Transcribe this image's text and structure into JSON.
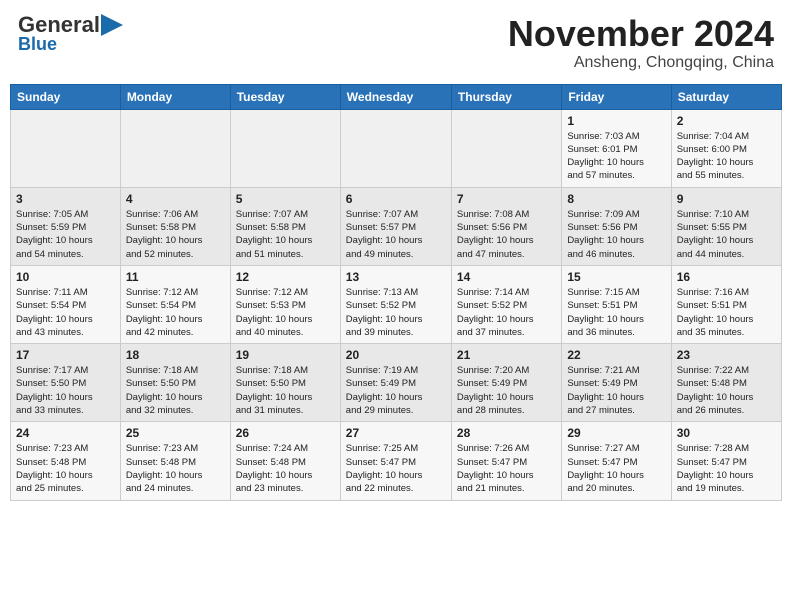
{
  "header": {
    "logo_line1": "General",
    "logo_line2": "Blue",
    "title": "November 2024",
    "subtitle": "Ansheng, Chongqing, China"
  },
  "weekdays": [
    "Sunday",
    "Monday",
    "Tuesday",
    "Wednesday",
    "Thursday",
    "Friday",
    "Saturday"
  ],
  "weeks": [
    [
      {
        "day": "",
        "info": ""
      },
      {
        "day": "",
        "info": ""
      },
      {
        "day": "",
        "info": ""
      },
      {
        "day": "",
        "info": ""
      },
      {
        "day": "",
        "info": ""
      },
      {
        "day": "1",
        "info": "Sunrise: 7:03 AM\nSunset: 6:01 PM\nDaylight: 10 hours\nand 57 minutes."
      },
      {
        "day": "2",
        "info": "Sunrise: 7:04 AM\nSunset: 6:00 PM\nDaylight: 10 hours\nand 55 minutes."
      }
    ],
    [
      {
        "day": "3",
        "info": "Sunrise: 7:05 AM\nSunset: 5:59 PM\nDaylight: 10 hours\nand 54 minutes."
      },
      {
        "day": "4",
        "info": "Sunrise: 7:06 AM\nSunset: 5:58 PM\nDaylight: 10 hours\nand 52 minutes."
      },
      {
        "day": "5",
        "info": "Sunrise: 7:07 AM\nSunset: 5:58 PM\nDaylight: 10 hours\nand 51 minutes."
      },
      {
        "day": "6",
        "info": "Sunrise: 7:07 AM\nSunset: 5:57 PM\nDaylight: 10 hours\nand 49 minutes."
      },
      {
        "day": "7",
        "info": "Sunrise: 7:08 AM\nSunset: 5:56 PM\nDaylight: 10 hours\nand 47 minutes."
      },
      {
        "day": "8",
        "info": "Sunrise: 7:09 AM\nSunset: 5:56 PM\nDaylight: 10 hours\nand 46 minutes."
      },
      {
        "day": "9",
        "info": "Sunrise: 7:10 AM\nSunset: 5:55 PM\nDaylight: 10 hours\nand 44 minutes."
      }
    ],
    [
      {
        "day": "10",
        "info": "Sunrise: 7:11 AM\nSunset: 5:54 PM\nDaylight: 10 hours\nand 43 minutes."
      },
      {
        "day": "11",
        "info": "Sunrise: 7:12 AM\nSunset: 5:54 PM\nDaylight: 10 hours\nand 42 minutes."
      },
      {
        "day": "12",
        "info": "Sunrise: 7:12 AM\nSunset: 5:53 PM\nDaylight: 10 hours\nand 40 minutes."
      },
      {
        "day": "13",
        "info": "Sunrise: 7:13 AM\nSunset: 5:52 PM\nDaylight: 10 hours\nand 39 minutes."
      },
      {
        "day": "14",
        "info": "Sunrise: 7:14 AM\nSunset: 5:52 PM\nDaylight: 10 hours\nand 37 minutes."
      },
      {
        "day": "15",
        "info": "Sunrise: 7:15 AM\nSunset: 5:51 PM\nDaylight: 10 hours\nand 36 minutes."
      },
      {
        "day": "16",
        "info": "Sunrise: 7:16 AM\nSunset: 5:51 PM\nDaylight: 10 hours\nand 35 minutes."
      }
    ],
    [
      {
        "day": "17",
        "info": "Sunrise: 7:17 AM\nSunset: 5:50 PM\nDaylight: 10 hours\nand 33 minutes."
      },
      {
        "day": "18",
        "info": "Sunrise: 7:18 AM\nSunset: 5:50 PM\nDaylight: 10 hours\nand 32 minutes."
      },
      {
        "day": "19",
        "info": "Sunrise: 7:18 AM\nSunset: 5:50 PM\nDaylight: 10 hours\nand 31 minutes."
      },
      {
        "day": "20",
        "info": "Sunrise: 7:19 AM\nSunset: 5:49 PM\nDaylight: 10 hours\nand 29 minutes."
      },
      {
        "day": "21",
        "info": "Sunrise: 7:20 AM\nSunset: 5:49 PM\nDaylight: 10 hours\nand 28 minutes."
      },
      {
        "day": "22",
        "info": "Sunrise: 7:21 AM\nSunset: 5:49 PM\nDaylight: 10 hours\nand 27 minutes."
      },
      {
        "day": "23",
        "info": "Sunrise: 7:22 AM\nSunset: 5:48 PM\nDaylight: 10 hours\nand 26 minutes."
      }
    ],
    [
      {
        "day": "24",
        "info": "Sunrise: 7:23 AM\nSunset: 5:48 PM\nDaylight: 10 hours\nand 25 minutes."
      },
      {
        "day": "25",
        "info": "Sunrise: 7:23 AM\nSunset: 5:48 PM\nDaylight: 10 hours\nand 24 minutes."
      },
      {
        "day": "26",
        "info": "Sunrise: 7:24 AM\nSunset: 5:48 PM\nDaylight: 10 hours\nand 23 minutes."
      },
      {
        "day": "27",
        "info": "Sunrise: 7:25 AM\nSunset: 5:47 PM\nDaylight: 10 hours\nand 22 minutes."
      },
      {
        "day": "28",
        "info": "Sunrise: 7:26 AM\nSunset: 5:47 PM\nDaylight: 10 hours\nand 21 minutes."
      },
      {
        "day": "29",
        "info": "Sunrise: 7:27 AM\nSunset: 5:47 PM\nDaylight: 10 hours\nand 20 minutes."
      },
      {
        "day": "30",
        "info": "Sunrise: 7:28 AM\nSunset: 5:47 PM\nDaylight: 10 hours\nand 19 minutes."
      }
    ]
  ]
}
